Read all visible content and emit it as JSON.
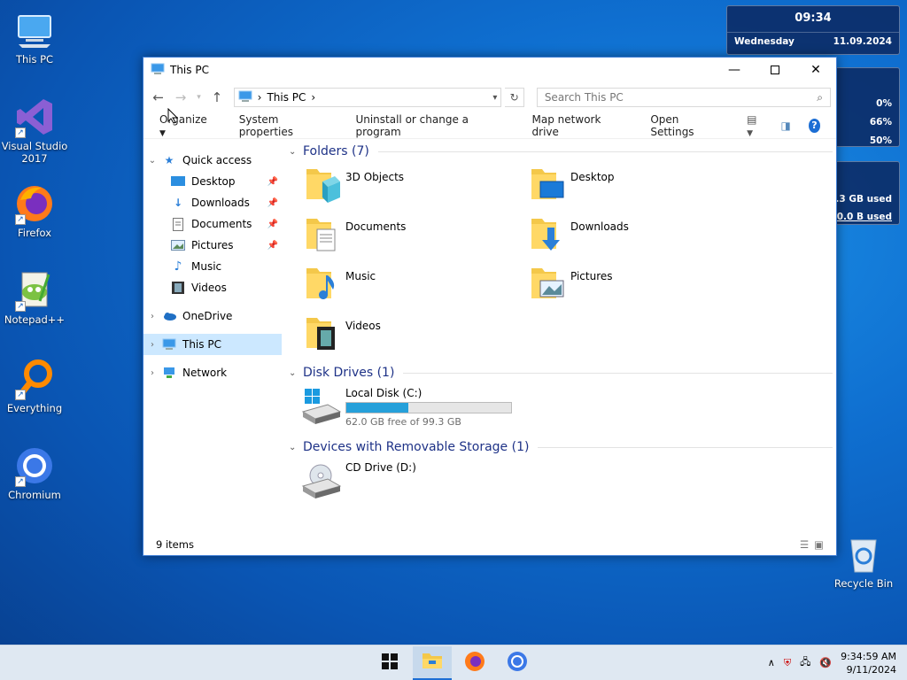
{
  "desktop_icons": [
    {
      "label": "This PC"
    },
    {
      "label": "Visual Studio 2017"
    },
    {
      "label": "Firefox"
    },
    {
      "label": "Notepad++"
    },
    {
      "label": "Everything"
    },
    {
      "label": "Chromium"
    },
    {
      "label": "Recycle Bin"
    }
  ],
  "clock_gadget": {
    "time": "09:34",
    "day": "Wednesday",
    "date": "11.09.2024"
  },
  "cpu_gadget": {
    "values": [
      "0%",
      "66%",
      "50%"
    ]
  },
  "disk_gadget": {
    "line1": "99.3 GB used",
    "line2": "B/0.0 B used"
  },
  "window": {
    "title": "This PC",
    "address": "This PC",
    "search_placeholder": "Search This PC",
    "toolbar": {
      "organize": "Organize",
      "system_properties": "System properties",
      "uninstall": "Uninstall or change a program",
      "map_drive": "Map network drive",
      "open_settings": "Open Settings"
    },
    "nav": {
      "quick_access": "Quick access",
      "items": [
        "Desktop",
        "Downloads",
        "Documents",
        "Pictures",
        "Music",
        "Videos"
      ],
      "onedrive": "OneDrive",
      "this_pc": "This PC",
      "network": "Network"
    },
    "groups": {
      "folders": "Folders (7)",
      "disk_drives": "Disk Drives (1)",
      "removable": "Devices with Removable Storage (1)"
    },
    "folders": [
      "3D Objects",
      "Desktop",
      "Documents",
      "Downloads",
      "Music",
      "Pictures",
      "Videos"
    ],
    "local_disk": {
      "name": "Local Disk (C:)",
      "free_text": "62.0 GB free of 99.3 GB",
      "used_fraction": 0.376
    },
    "cd_drive": {
      "name": "CD Drive (D:)"
    },
    "status": "9 items"
  },
  "taskbar": {
    "time": "9:34:59 AM",
    "date": "9/11/2024"
  },
  "colors": {
    "accent": "#1c6ed4",
    "selection": "#cce8ff",
    "group_heading": "#1e3287",
    "disk_fill": "#26a0da"
  }
}
